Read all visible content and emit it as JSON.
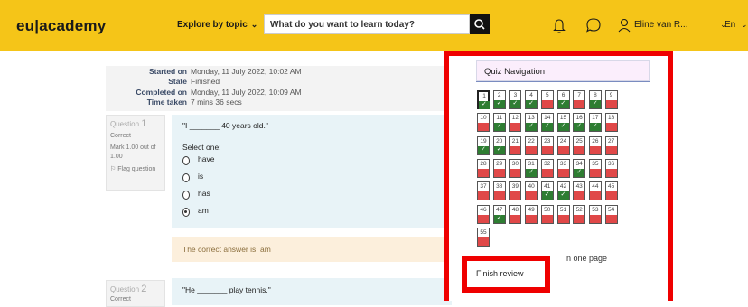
{
  "header": {
    "logo": "eu|academy",
    "explore_label": "Explore by topic",
    "explore_chevron": "⌄",
    "search_placeholder": "What do you want to learn today?",
    "username": "Eline van R...",
    "language": "En",
    "icons": [
      "search-icon",
      "bell-icon",
      "chat-icon",
      "user-icon",
      "chevron-down-icon"
    ],
    "accent_color": "#f5c518"
  },
  "summary": {
    "rows": [
      {
        "key": "Started on",
        "value": "Monday, 11 July 2022, 10:02 AM"
      },
      {
        "key": "State",
        "value": "Finished"
      },
      {
        "key": "Completed on",
        "value": "Monday, 11 July 2022, 10:09 AM"
      },
      {
        "key": "Time taken",
        "value": "7 mins 36 secs"
      }
    ]
  },
  "question1": {
    "label": "Question",
    "number": "1",
    "status": "Correct",
    "mark": "Mark 1.00 out of 1.00",
    "flag": "Flag question",
    "text": "\"I _______ 40 years old.\"",
    "select_one": "Select one:",
    "options": [
      "have",
      "is",
      "has",
      "am"
    ],
    "selected": "am",
    "correct_answer": "The correct answer is: am"
  },
  "question2": {
    "label": "Question",
    "number": "2",
    "status": "Correct",
    "text": "\"He _______ play tennis.\""
  },
  "quiz_nav": {
    "title": "Quiz Navigation",
    "cells": [
      {
        "n": "1",
        "s": "correct"
      },
      {
        "n": "2",
        "s": "correct"
      },
      {
        "n": "3",
        "s": "correct"
      },
      {
        "n": "4",
        "s": "correct"
      },
      {
        "n": "5",
        "s": "wrong"
      },
      {
        "n": "6",
        "s": "correct"
      },
      {
        "n": "7",
        "s": "wrong"
      },
      {
        "n": "8",
        "s": "correct"
      },
      {
        "n": "9",
        "s": "wrong"
      },
      {
        "n": "10",
        "s": "wrong"
      },
      {
        "n": "11",
        "s": "correct"
      },
      {
        "n": "12",
        "s": "wrong"
      },
      {
        "n": "13",
        "s": "correct"
      },
      {
        "n": "14",
        "s": "correct"
      },
      {
        "n": "15",
        "s": "correct"
      },
      {
        "n": "16",
        "s": "correct"
      },
      {
        "n": "17",
        "s": "correct"
      },
      {
        "n": "18",
        "s": "wrong"
      },
      {
        "n": "19",
        "s": "correct"
      },
      {
        "n": "20",
        "s": "correct"
      },
      {
        "n": "21",
        "s": "wrong"
      },
      {
        "n": "22",
        "s": "wrong"
      },
      {
        "n": "23",
        "s": "wrong"
      },
      {
        "n": "24",
        "s": "wrong"
      },
      {
        "n": "25",
        "s": "wrong"
      },
      {
        "n": "26",
        "s": "wrong"
      },
      {
        "n": "27",
        "s": "wrong"
      },
      {
        "n": "28",
        "s": "wrong"
      },
      {
        "n": "29",
        "s": "wrong"
      },
      {
        "n": "30",
        "s": "wrong"
      },
      {
        "n": "31",
        "s": "correct"
      },
      {
        "n": "32",
        "s": "wrong"
      },
      {
        "n": "33",
        "s": "wrong"
      },
      {
        "n": "34",
        "s": "correct"
      },
      {
        "n": "35",
        "s": "wrong"
      },
      {
        "n": "36",
        "s": "wrong"
      },
      {
        "n": "37",
        "s": "wrong"
      },
      {
        "n": "38",
        "s": "wrong"
      },
      {
        "n": "39",
        "s": "wrong"
      },
      {
        "n": "40",
        "s": "wrong"
      },
      {
        "n": "41",
        "s": "correct"
      },
      {
        "n": "42",
        "s": "correct"
      },
      {
        "n": "43",
        "s": "wrong"
      },
      {
        "n": "44",
        "s": "wrong"
      },
      {
        "n": "45",
        "s": "wrong"
      },
      {
        "n": "46",
        "s": "wrong"
      },
      {
        "n": "47",
        "s": "correct"
      },
      {
        "n": "48",
        "s": "wrong"
      },
      {
        "n": "49",
        "s": "wrong"
      },
      {
        "n": "50",
        "s": "wrong"
      },
      {
        "n": "51",
        "s": "wrong"
      },
      {
        "n": "52",
        "s": "wrong"
      },
      {
        "n": "53",
        "s": "wrong"
      },
      {
        "n": "54",
        "s": "wrong"
      },
      {
        "n": "55",
        "s": "wrong"
      }
    ],
    "show_one_page": "n one page",
    "finish_review": "Finish review",
    "correct_color": "#2e7d32",
    "wrong_color": "#e04848",
    "highlight_color": "#ef0000"
  }
}
